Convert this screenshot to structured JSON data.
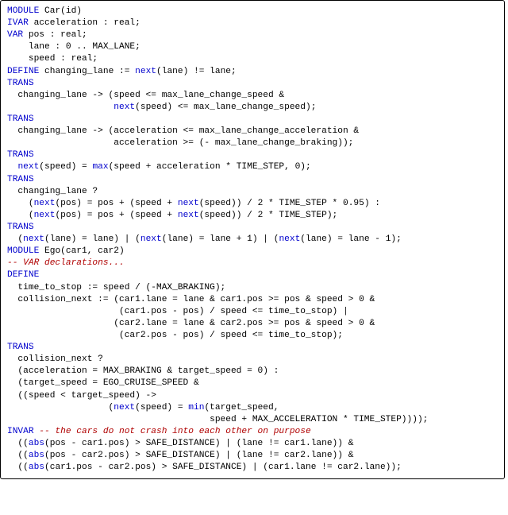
{
  "code": {
    "l1a": "MODULE",
    "l1b": " Car(id)",
    "l2a": "IVAR",
    "l2b": " acceleration : real;",
    "l3a": "VAR",
    "l3b": " pos : real;",
    "l4": "    lane : 0 .. MAX_LANE;",
    "l5": "    speed : real;",
    "l6a": "DEFINE",
    "l6b": " changing_lane := ",
    "l6c": "next",
    "l6d": "(lane) != lane;",
    "l7": "TRANS",
    "l8": "  changing_lane -> (speed <= max_lane_change_speed &",
    "l9a": "                    ",
    "l9b": "next",
    "l9c": "(speed) <= max_lane_change_speed);",
    "l10": "TRANS",
    "l11": "  changing_lane -> (acceleration <= max_lane_change_acceleration &",
    "l12": "                    acceleration >= (- max_lane_change_braking));",
    "l13": "TRANS",
    "l14a": "  ",
    "l14b": "next",
    "l14c": "(speed) = ",
    "l14d": "max",
    "l14e": "(speed + acceleration * TIME_STEP, 0);",
    "l15": "TRANS",
    "l16": "  changing_lane ?",
    "l17a": "    (",
    "l17b": "next",
    "l17c": "(pos) = pos + (speed + ",
    "l17d": "next",
    "l17e": "(speed)) / 2 * TIME_STEP * 0.95) :",
    "l18a": "    (",
    "l18b": "next",
    "l18c": "(pos) = pos + (speed + ",
    "l18d": "next",
    "l18e": "(speed)) / 2 * TIME_STEP);",
    "l19": "TRANS",
    "l20a": "  (",
    "l20b": "next",
    "l20c": "(lane) = lane) | (",
    "l20d": "next",
    "l20e": "(lane) = lane + 1) | (",
    "l20f": "next",
    "l20g": "(lane) = lane - 1);",
    "l21": "",
    "l22": "",
    "l23a": "MODULE",
    "l23b": " Ego(car1, car2)",
    "l24": "-- VAR declarations...",
    "l25": "DEFINE",
    "l26": "  time_to_stop := speed / (-MAX_BRAKING);",
    "l27": "  collision_next := (car1.lane = lane & car1.pos >= pos & speed > 0 &",
    "l28": "                     (car1.pos - pos) / speed <= time_to_stop) |",
    "l29": "                    (car2.lane = lane & car2.pos >= pos & speed > 0 &",
    "l30": "                     (car2.pos - pos) / speed <= time_to_stop);",
    "l31": "TRANS",
    "l32": "  collision_next ?",
    "l33": "  (acceleration = MAX_BRAKING & target_speed = 0) :",
    "l34": "  (target_speed = EGO_CRUISE_SPEED &",
    "l35": "  ((speed < target_speed) ->",
    "l36a": "                   (",
    "l36b": "next",
    "l36c": "(speed) = ",
    "l36d": "min",
    "l36e": "(target_speed,",
    "l37": "                                      speed + MAX_ACCELERATION * TIME_STEP))));",
    "l38": "",
    "l39a": "INVAR",
    "l39b": " ",
    "l39c": "-- the cars do not crash into each other on purpose",
    "l40a": "  ((",
    "l40b": "abs",
    "l40c": "(pos - car1.pos) > SAFE_DISTANCE) | (lane != car1.lane)) &",
    "l41a": "  ((",
    "l41b": "abs",
    "l41c": "(pos - car2.pos) > SAFE_DISTANCE) | (lane != car2.lane)) &",
    "l42a": "  ((",
    "l42b": "abs",
    "l42c": "(car1.pos - car2.pos) > SAFE_DISTANCE) | (car1.lane != car2.lane));"
  }
}
